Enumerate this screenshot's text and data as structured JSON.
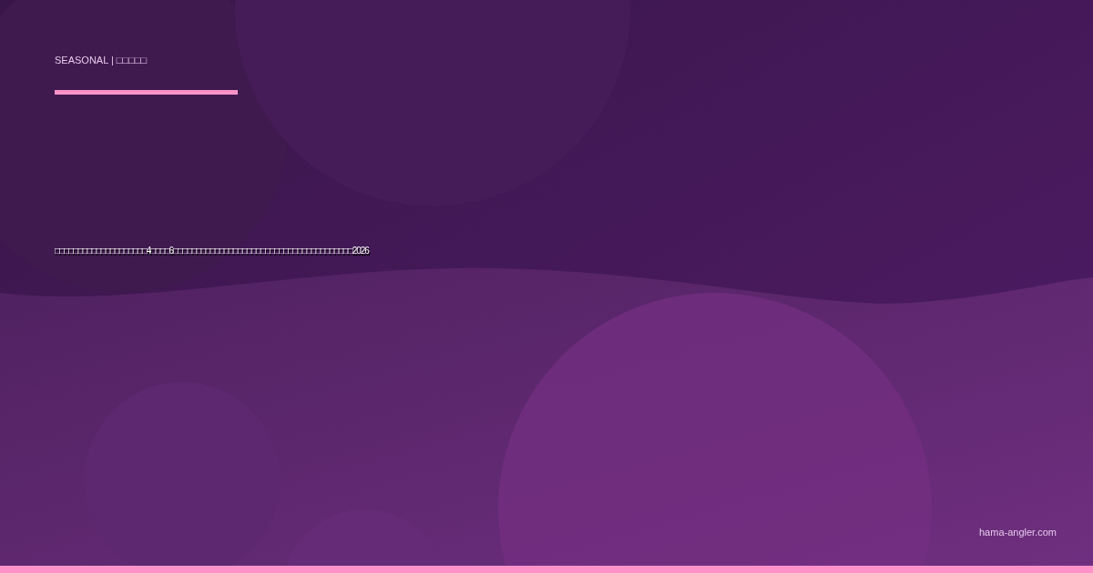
{
  "eyebrow": "SEASONAL | □□□□□",
  "title": "□□□□□□□□□□□□□□□□□□□□4□□□□6□□□□□□□□□□□□□□□□□□□□□□□□□□□□□□□□□□□□□□□2026",
  "domain": "hama-angler.com"
}
